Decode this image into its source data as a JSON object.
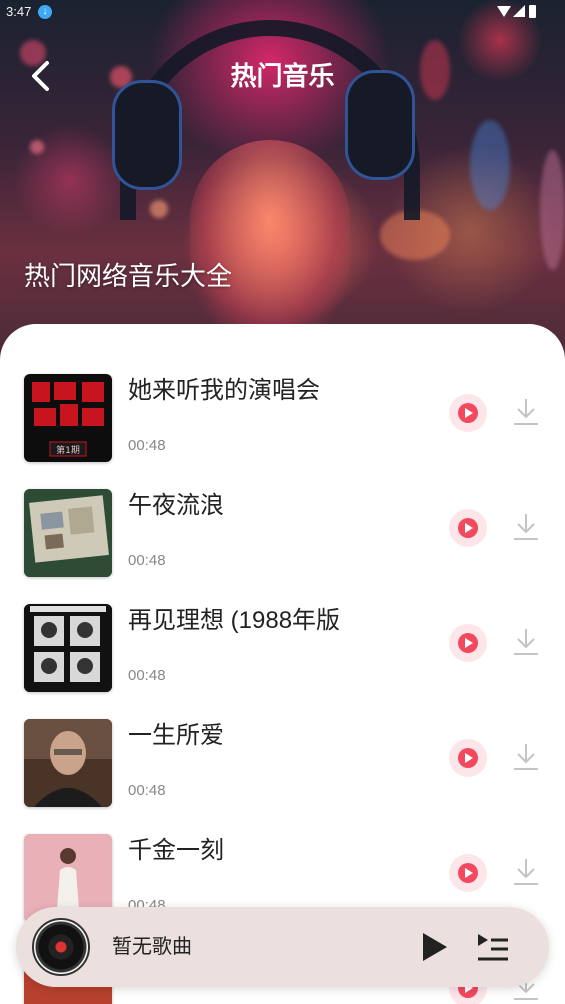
{
  "status_bar": {
    "time": "3:47"
  },
  "header": {
    "title": "热门音乐",
    "subtitle": "热门网络音乐大全"
  },
  "songs": [
    {
      "title": "她来听我的演唱会",
      "duration": "00:48",
      "cover_text": "第1期"
    },
    {
      "title": "午夜流浪",
      "duration": "00:48"
    },
    {
      "title": "再见理想 (1988年版",
      "duration": "00:48"
    },
    {
      "title": "一生所爱",
      "duration": "00:48"
    },
    {
      "title": "千金一刻",
      "duration": "00:48"
    }
  ],
  "player": {
    "now_playing": "暂无歌曲"
  },
  "colors": {
    "accent": "#f2495f",
    "accent_bg": "#fde6ea",
    "player_bg": "#ece0df"
  },
  "icons": {
    "back": "chevron-left-icon",
    "play": "play-icon",
    "download": "download-icon",
    "playlist": "playlist-icon",
    "disc": "vinyl-disc-icon"
  }
}
